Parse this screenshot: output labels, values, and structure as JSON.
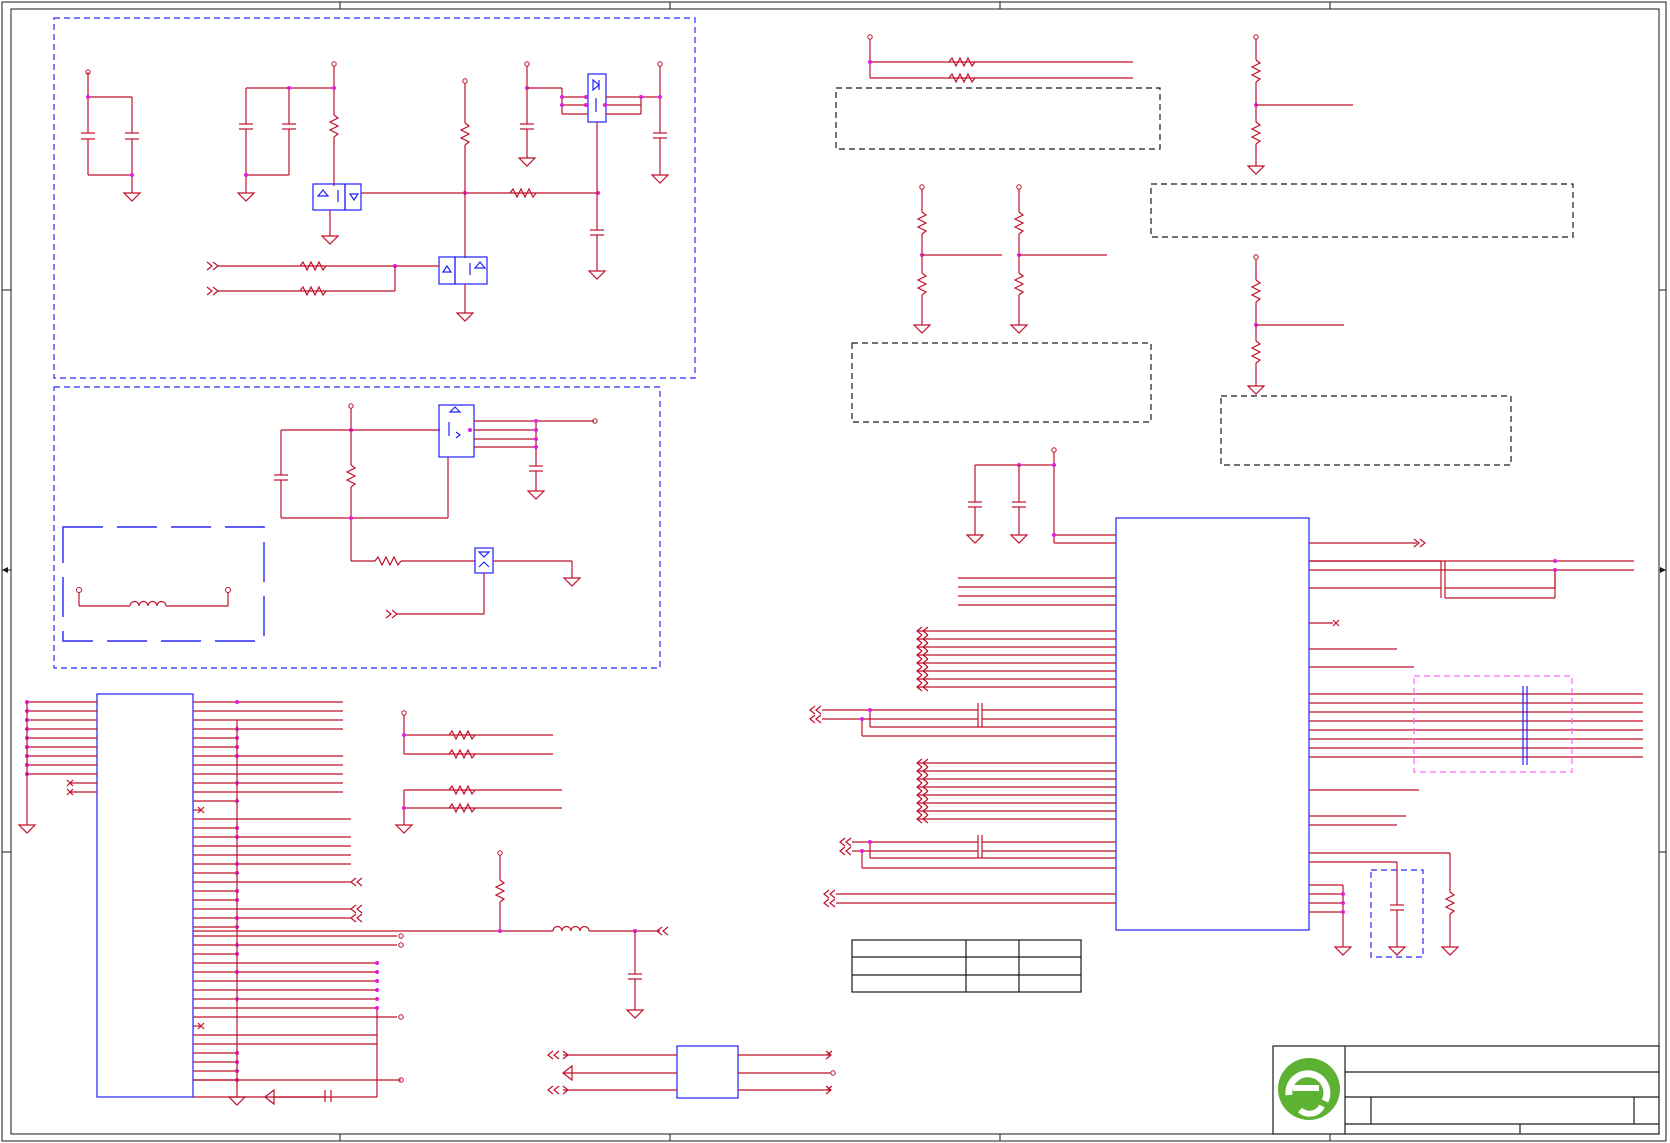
{
  "document": {
    "type": "schematic-sheet",
    "title_block": {
      "logo": "company-logo-green-e",
      "rows": [
        "",
        "",
        "",
        ""
      ]
    },
    "table": {
      "rows": [
        [
          "",
          "",
          ""
        ],
        [
          "",
          "",
          ""
        ],
        [
          "",
          "",
          ""
        ]
      ]
    }
  },
  "colors": {
    "wire": "#c0102b",
    "part": "#2020ff",
    "junction": "#e01ee0",
    "frame": "#1a1a1a",
    "logo": "#5db234"
  }
}
